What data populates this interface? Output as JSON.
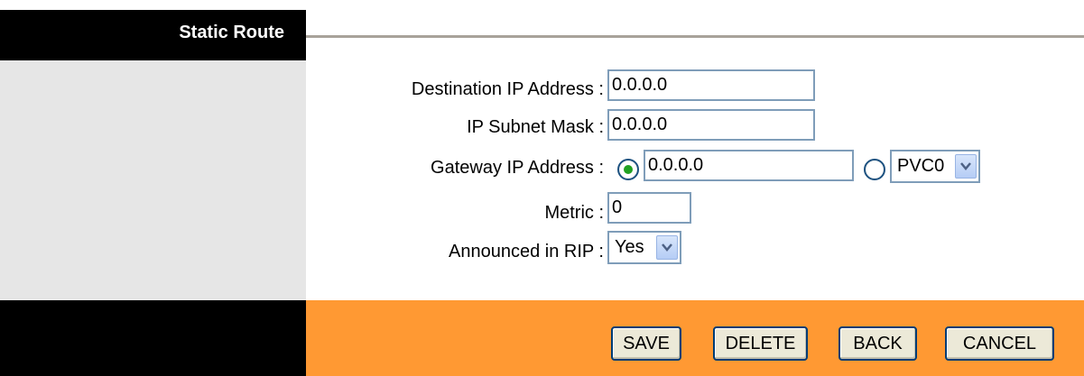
{
  "sidebar": {
    "title": "Static Route"
  },
  "form": {
    "destination": {
      "label": "Destination IP Address :",
      "value": "0.0.0.0"
    },
    "subnet": {
      "label": "IP Subnet Mask :",
      "value": "0.0.0.0"
    },
    "gateway": {
      "label": "Gateway IP Address :",
      "ip_value": "0.0.0.0",
      "ip_selected": true,
      "pvc_selected": false,
      "pvc_value": "PVC0"
    },
    "metric": {
      "label": "Metric :",
      "value": "0"
    },
    "rip": {
      "label": "Announced in RIP :",
      "value": "Yes"
    }
  },
  "buttons": {
    "save": "SAVE",
    "delete": "DELETE",
    "back": "BACK",
    "cancel": "CANCEL"
  },
  "colors": {
    "sidebar": "#000000",
    "sidebar_body": "#e6e6e6",
    "footer": "#ff9933",
    "rule": "#a8a29a"
  },
  "icons": {
    "selected_radio": "radio-selected-icon",
    "unselected_radio": "radio-unselected-icon",
    "dropdown": "chevron-down-icon"
  }
}
